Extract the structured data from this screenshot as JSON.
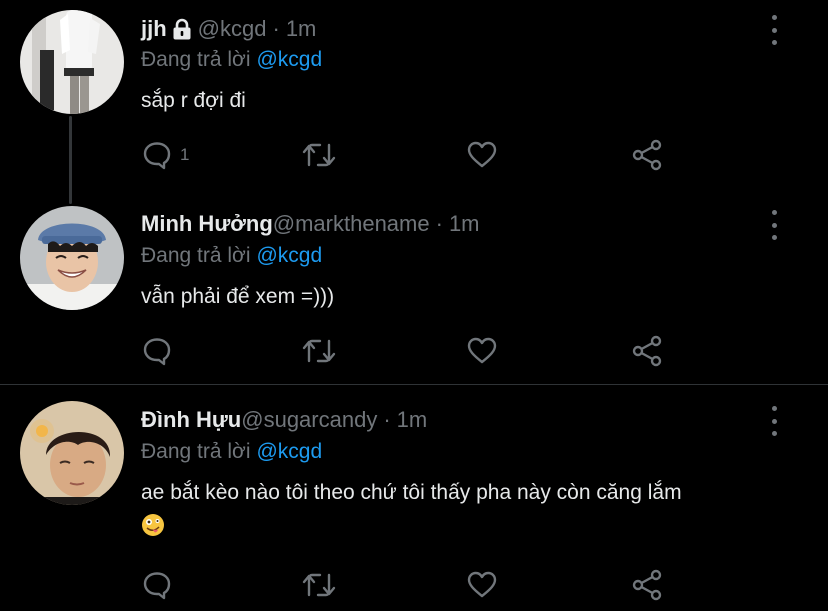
{
  "thread": [
    {
      "name": "jjh",
      "handle": "@kcgd",
      "dot": "·",
      "time": "1m",
      "reply_prefix": "Đang trả lời",
      "reply_mention": "@kcgd",
      "text": "sắp r đợi đi",
      "replies": "1",
      "protected": true,
      "avatar": "avatar-person-standing"
    },
    {
      "name": "Minh Hưởng",
      "handle": "@markthename",
      "dot": "·",
      "time": "1m",
      "reply_prefix": "Đang trả lời",
      "reply_mention": "@kcgd",
      "text": "vẫn phải để xem =)))",
      "replies": "",
      "avatar": "avatar-smiling-boy-bucket-hat"
    },
    {
      "name": "Đình Hựu",
      "handle": "@sugarcandy",
      "dot": "·",
      "time": "1m",
      "reply_prefix": "Đang trả lời",
      "reply_mention": "@kcgd",
      "text": "ae bắt kèo nào tôi theo chứ tôi thấy pha này còn căng lắm",
      "emoji": "zany-face-emoji",
      "replies": "",
      "avatar": "avatar-boy-warm-light"
    }
  ],
  "colors": {
    "background": "#000000",
    "text": "#e7e9ea",
    "muted": "#71767b",
    "link": "#1d9bf0",
    "divider": "#2f3336"
  },
  "icons": [
    "reply-icon",
    "retweet-icon",
    "like-icon",
    "share-icon",
    "more-icon",
    "lock-icon"
  ]
}
